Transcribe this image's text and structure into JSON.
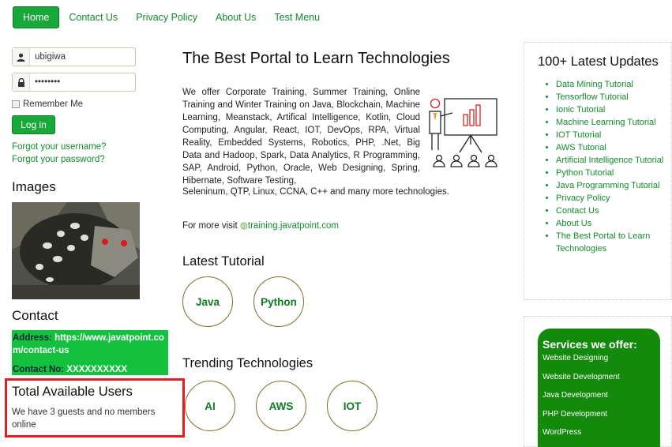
{
  "nav": {
    "home": "Home",
    "contact": "Contact Us",
    "privacy": "Privacy Policy",
    "about": "About Us",
    "test": "Test Menu"
  },
  "login": {
    "username": "ubigiwa",
    "password": "••••••••",
    "remember": "Remember Me",
    "button": "Log in",
    "forgot_user": "Forgot your username?",
    "forgot_pass": "Forgot your password?"
  },
  "images": {
    "title": "Images"
  },
  "contact": {
    "title": "Contact",
    "address_label": "Address:",
    "address_line1": "https://www.javatpoint.co",
    "address_line2": "m/contact-us",
    "phone_label": "Contact No:",
    "phone": "XXXXXXXXXX"
  },
  "users": {
    "title": "Total Available Users",
    "text": "We have 3 guests and no members online"
  },
  "main": {
    "title": "The Best Portal to Learn Technologies",
    "intro": "We offer Corporate Training, Summer Training, Online Training and Winter Training on Java, Blockchain, Machine Learning, Meanstack, Artifical Intelligence, Kotlin, Cloud Computing, Angular, React, IOT, DevOps, RPA, Virtual Reality, Embedded Systems, Robotics, PHP, .Net, Big Data and Hadoop, Spark, Data Analytics, R Programming, SAP, Android, Python, Oracle, Web Designing, Spring, Hibernate, Software Testing,",
    "intro_tail": "Seleninum, QTP, Linux, CCNA, C++ and many more technologies.",
    "visit_prefix": "For more visit",
    "visit_link": "training.javatpoint.com",
    "latest_title": "Latest Tutorial",
    "latest": [
      "Java",
      "Python"
    ],
    "trending_title": "Trending Technologies",
    "trending": [
      "AI",
      "AWS",
      "IOT"
    ]
  },
  "updates": {
    "title": "100+ Latest Updates",
    "items": [
      "Data Mining Tutorial",
      "Tensorflow Tutorial",
      "Ionic Tutorial",
      "Machine Learning Tutorial",
      "IOT Tutorial",
      "AWS Tutorial",
      "Artificial Intelligence Tutorial",
      "Python Tutorial",
      "Java Programming Tutorial",
      "Privacy Policy",
      "Contact Us",
      "About Us",
      "The Best Portal to Learn Technologies"
    ]
  },
  "services": {
    "title": "Services we offer:",
    "items": [
      "Website Designing",
      "Website Development",
      "Java Development",
      "PHP Development",
      "WordPress"
    ]
  },
  "colors": {
    "accent": "#18a93a",
    "link": "#138b2c",
    "highlight": "#e02020",
    "services_bg": "#138a0c"
  }
}
